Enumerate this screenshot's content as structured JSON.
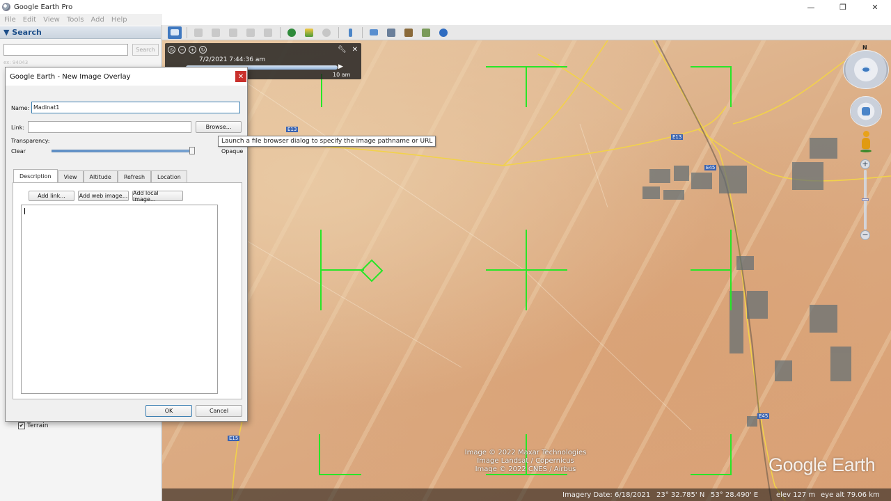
{
  "window": {
    "title": "Google Earth Pro",
    "minimize": "—",
    "maximize": "❐",
    "close": "✕"
  },
  "menu": [
    "File",
    "Edit",
    "View",
    "Tools",
    "Add",
    "Help"
  ],
  "search": {
    "header": "▼ Search",
    "button": "Search",
    "hint": "ex: 94043"
  },
  "layers": {
    "terrain_label": "Terrain",
    "terrain_checked": true
  },
  "timeslider": {
    "datetime": "7/2/2021   7:44:36 am",
    "end_label": "10 am"
  },
  "navigation": {
    "north": "N"
  },
  "dialog": {
    "title": "Google Earth - New Image Overlay",
    "close": "✕",
    "name_label": "Name:",
    "name_value": "Madinat1",
    "link_label": "Link:",
    "link_value": "",
    "browse_button": "Browse...",
    "transparency_label": "Transparency:",
    "clear_label": "Clear",
    "opaque_label": "Opaque",
    "tabs": [
      "Description",
      "View",
      "Altitude",
      "Refresh",
      "Location"
    ],
    "active_tab": "Description",
    "add_link_button": "Add link...",
    "add_web_image_button": "Add web image...",
    "add_local_image_button": "Add local image...",
    "ok_button": "OK",
    "cancel_button": "Cancel"
  },
  "tooltip": "Launch a file browser dialog to specify the image pathname or URL",
  "map": {
    "road_labels": [
      "E13",
      "E13",
      "E45",
      "E45",
      "E15"
    ],
    "attribution": [
      "Image © 2022 Maxar Technologies",
      "Image Landsat / Copernicus",
      "Image © 2022 CNES / Airbus"
    ],
    "logo": "Google Earth"
  },
  "status": {
    "imagery_date": "Imagery Date: 6/18/2021",
    "lat": "23° 32.785' N",
    "lon": "53° 28.490' E",
    "elev": "elev  127 m",
    "eye_alt": "eye alt  79.06 km"
  },
  "colors": {
    "overlay_green": "#27e627",
    "road_yellow": "#f2d24a",
    "sand": "#dcae86"
  }
}
